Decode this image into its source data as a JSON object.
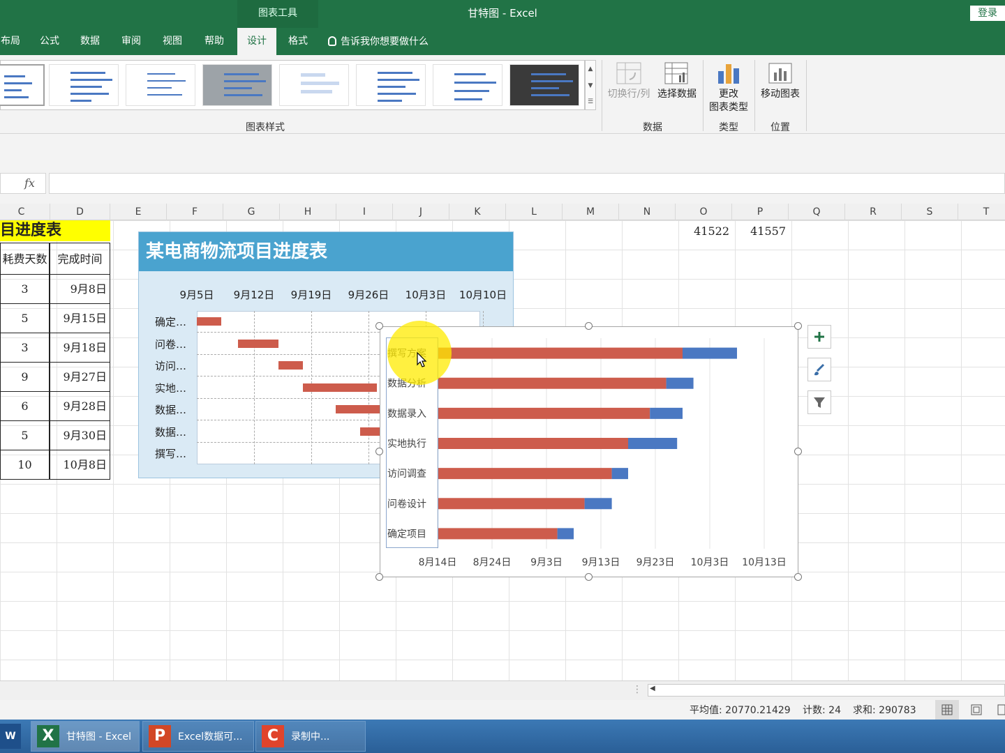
{
  "window": {
    "title": "甘特图  -  Excel",
    "context_tab": "图表工具",
    "login": "登录"
  },
  "tabs": [
    {
      "label": "布局"
    },
    {
      "label": "公式"
    },
    {
      "label": "数据"
    },
    {
      "label": "审阅"
    },
    {
      "label": "视图"
    },
    {
      "label": "帮助"
    },
    {
      "label": "设计",
      "active": true
    },
    {
      "label": "格式"
    }
  ],
  "tell_me": "告诉我你想要做什么",
  "ribbon": {
    "styles_group": "图表样式",
    "data_group": "数据",
    "type_group": "类型",
    "location_group": "位置",
    "switch_row_col": "切换行/列",
    "select_data": "选择数据",
    "change_type_line1": "更改",
    "change_type_line2": "图表类型",
    "move_chart": "移动图表"
  },
  "formula_bar": {
    "fx": "fx",
    "value": ""
  },
  "columns": [
    "C",
    "D",
    "E",
    "F",
    "G",
    "H",
    "I",
    "J",
    "K",
    "L",
    "M",
    "N",
    "O",
    "P",
    "Q",
    "R",
    "S",
    "T"
  ],
  "sheet": {
    "title_fragment": "目进度表",
    "header_days": "耗费天数",
    "header_finish": "完成时间",
    "rows": [
      {
        "days": "3",
        "finish": "9月8日"
      },
      {
        "days": "5",
        "finish": "9月15日"
      },
      {
        "days": "3",
        "finish": "9月18日"
      },
      {
        "days": "9",
        "finish": "9月27日"
      },
      {
        "days": "6",
        "finish": "9月28日"
      },
      {
        "days": "5",
        "finish": "9月30日"
      },
      {
        "days": "10",
        "finish": "10月8日"
      }
    ],
    "o1": "41522",
    "p1": "41557"
  },
  "chart_data": [
    {
      "type": "bar",
      "title": "某电商物流项目进度表",
      "x_ticks": [
        "9月5日",
        "9月12日",
        "9月19日",
        "9月26日",
        "10月3日",
        "10月10日"
      ],
      "categories": [
        "确定…",
        "问卷…",
        "访问…",
        "实地…",
        "数据…",
        "数据…",
        "撰写…"
      ],
      "visible_bars_approx": [
        {
          "start": "9月5日",
          "end": "9月8日"
        },
        {
          "start": "9月10日",
          "end": "9月15日"
        },
        {
          "start": "9月15日",
          "end": "9月18日"
        },
        {
          "start": "9月18日",
          "end": "9月27日"
        },
        {
          "start": "9月22日",
          "end": "9月28日"
        },
        {
          "start": "9月25日",
          "end": "9月30日"
        }
      ],
      "bar_color": "#cd5c4c"
    },
    {
      "type": "bar",
      "orientation": "horizontal",
      "stacked": true,
      "categories": [
        "确定项目",
        "问卷设计",
        "访问调查",
        "实地执行",
        "数据录入",
        "数据分析",
        "撰写方案"
      ],
      "x_ticks": [
        "8月14日",
        "8月24日",
        "9月3日",
        "9月13日",
        "9月23日",
        "10月3日",
        "10月13日"
      ],
      "xlim": [
        "8月14日",
        "10月13日"
      ],
      "series": [
        {
          "color": "#cd5c4c",
          "values": [
            "9月5日",
            "9月10日",
            "9月15日",
            "9月18日",
            "9月22日",
            "9月25日",
            "9月28日"
          ]
        },
        {
          "color": "#4a78c2",
          "values": [
            3,
            5,
            3,
            9,
            6,
            5,
            10
          ]
        }
      ]
    }
  ],
  "chart_side_buttons": [
    {
      "icon": "plus-icon"
    },
    {
      "icon": "brush-icon"
    },
    {
      "icon": "filter-icon"
    }
  ],
  "status": {
    "average": "平均值: 20770.21429",
    "count": "计数: 24",
    "sum": "求和: 290783"
  },
  "taskbar": [
    {
      "label": "甘特图 - Excel",
      "icon": "X"
    },
    {
      "label": "Excel数据可...",
      "icon": "P"
    },
    {
      "label": "录制中...",
      "icon": "C"
    }
  ]
}
